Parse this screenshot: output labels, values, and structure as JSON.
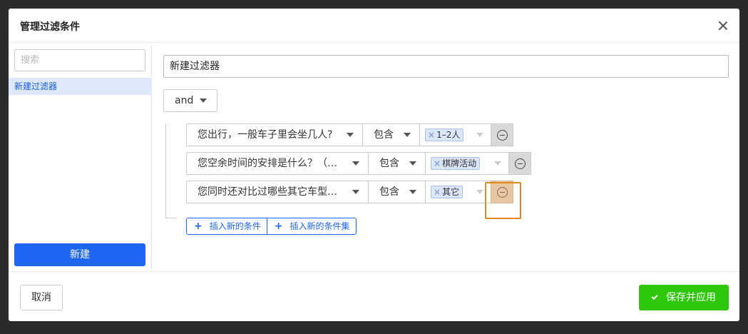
{
  "dialog": {
    "title": "管理过滤条件"
  },
  "sidebar": {
    "search_placeholder": "搜索",
    "items": [
      {
        "label": "新建过滤器"
      }
    ],
    "new_button": "新建"
  },
  "main": {
    "filter_name": "新建过滤器",
    "logic_select": "and",
    "conditions": [
      {
        "field": "您出行，一般车子里会坐几人?",
        "operator": "包含",
        "tags": [
          "1–2人"
        ]
      },
      {
        "field": "您空余时间的安排是什么？（…",
        "operator": "包含",
        "tags": [
          "棋牌活动"
        ]
      },
      {
        "field": "您同时还对比过哪些其它车型…",
        "operator": "包含",
        "tags": [
          "其它"
        ]
      }
    ],
    "insert_condition": "插入新的条件",
    "insert_condition_set": "插入新的条件集"
  },
  "footer": {
    "cancel": "取消",
    "save_apply": "保存并应用"
  },
  "icons": {
    "close": "close-icon",
    "caret": "caret-down-icon",
    "remove": "minus-circle-icon",
    "plus": "plus-icon",
    "check": "check-icon",
    "tag_remove": "x-icon"
  },
  "colors": {
    "primary": "#1f66f2",
    "success": "#2ec70b",
    "highlight": "#e08a1e"
  }
}
